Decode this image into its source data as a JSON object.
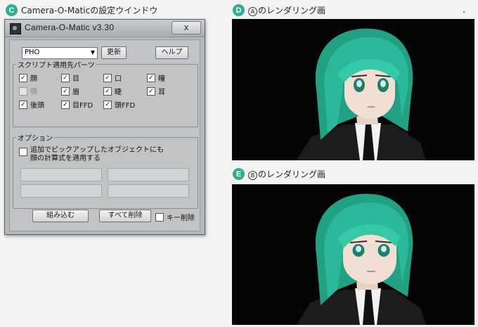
{
  "captions": {
    "c": {
      "badge": "C",
      "text": "Camera-O-Maticの設定ウインドウ"
    },
    "d": {
      "badge": "D",
      "mark": "A",
      "text": "のレンダリング画"
    },
    "e": {
      "badge": "E",
      "mark": "B",
      "text": "のレンダリング画"
    }
  },
  "window": {
    "title": "Camera-O-Matic v3.30",
    "close_label": "x",
    "preset": "PHO",
    "update_button": "更新",
    "help_button": "ヘルプ",
    "parts_group": {
      "title": "スクリプト適用先パーツ",
      "items": [
        {
          "label": "顔",
          "checked": true,
          "enabled": true
        },
        {
          "label": "目",
          "checked": true,
          "enabled": true
        },
        {
          "label": "口",
          "checked": true,
          "enabled": true
        },
        {
          "label": "瞳",
          "checked": true,
          "enabled": true
        },
        {
          "label": "顎",
          "checked": false,
          "enabled": false
        },
        {
          "label": "眉",
          "checked": true,
          "enabled": true
        },
        {
          "label": "睫",
          "checked": true,
          "enabled": true
        },
        {
          "label": "耳",
          "checked": true,
          "enabled": true
        },
        {
          "label": "後頭",
          "checked": true,
          "enabled": true
        },
        {
          "label": "目FFD",
          "checked": true,
          "enabled": true
        },
        {
          "label": "頭FFD",
          "checked": true,
          "enabled": true
        }
      ]
    },
    "options_group": {
      "title": "オプション",
      "option_line1": "追加でピックアップしたオブジェクトにも",
      "option_line2": "顔の計算式を適用する",
      "option_checked": false
    },
    "embed_button": "組み込む",
    "delete_all_button": "すべて削除",
    "key_delete_label": "キー削除",
    "key_delete_checked": false
  },
  "colors": {
    "badge": "#2fae92",
    "hair": "#2cb89a",
    "skin": "#f1dfd3",
    "render_bg": "#050505"
  }
}
